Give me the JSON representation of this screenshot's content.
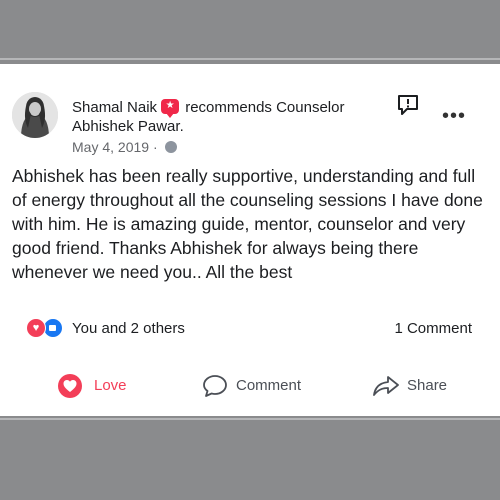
{
  "post": {
    "author_name": "Shamal Naik",
    "recommends_text": "recommends Counselor",
    "recommended_name": "Abhishek Pawar.",
    "date": "May 4, 2019",
    "date_separator": "·",
    "body": "Abhishek has been really supportive, understanding and full of energy throughout all the counseling sessions I have done with him. He is amazing guide, mentor, counselor and very good friend. Thanks Abhishek for always being there whenever we need you.. All the best",
    "more_label": "•••"
  },
  "engagement": {
    "reactions_label": "You and 2 others",
    "comments_label": "1 Comment"
  },
  "actions": {
    "love": "Love",
    "comment": "Comment",
    "share": "Share"
  },
  "colors": {
    "love_red": "#f33e58",
    "like_blue": "#1877f2",
    "recommend_badge": "#f02849",
    "frame_gray": "#8a8b8d"
  },
  "icons": {
    "recommend": "star-badge-icon",
    "audience": "globe-icon",
    "report": "report-flag-icon",
    "more": "more-options-icon",
    "love_reaction": "love-reaction-icon",
    "like_reaction": "like-reaction-icon",
    "comment": "comment-bubble-icon",
    "share": "share-arrow-icon"
  }
}
